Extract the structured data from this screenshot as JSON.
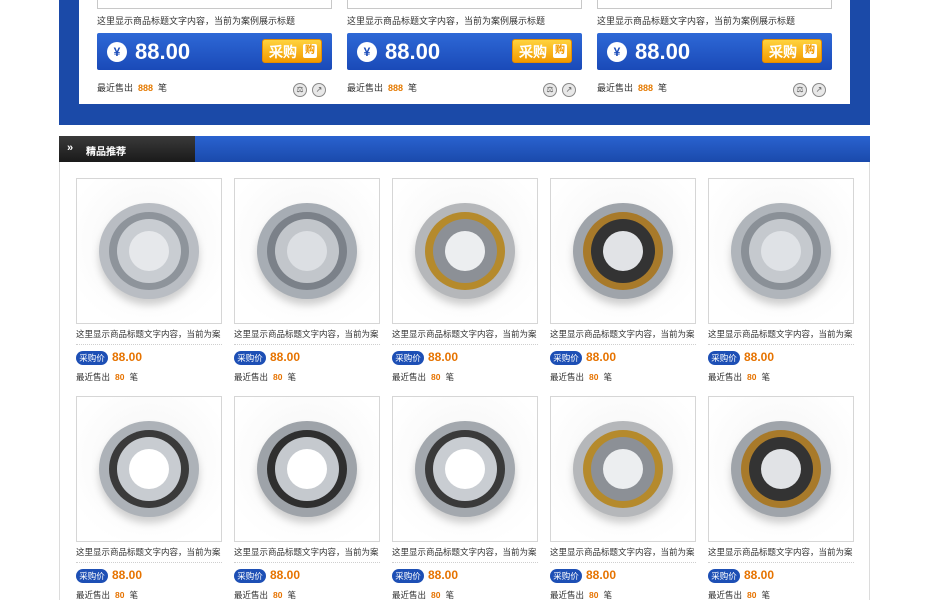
{
  "top_cards": [
    {
      "title": "这里显示商品标题文字内容，当前为案例展示标题",
      "currency": "¥",
      "price": "88.00",
      "buy_label": "采购",
      "basket": "购",
      "sold_prefix": "最近售出",
      "sold_count": "888",
      "sold_unit": "笔"
    },
    {
      "title": "这里显示商品标题文字内容，当前为案例展示标题",
      "currency": "¥",
      "price": "88.00",
      "buy_label": "采购",
      "basket": "购",
      "sold_prefix": "最近售出",
      "sold_count": "888",
      "sold_unit": "笔"
    },
    {
      "title": "这里显示商品标题文字内容，当前为案例展示标题",
      "currency": "¥",
      "price": "88.00",
      "buy_label": "采购",
      "basket": "购",
      "sold_prefix": "最近售出",
      "sold_count": "888",
      "sold_unit": "笔"
    }
  ],
  "section": {
    "chevron": "»",
    "title": "精品推荐"
  },
  "colors": {
    "brand_blue": "#1b4aa8",
    "price_orange": "#e67300",
    "buy_button": "#f29a00"
  },
  "products": [
    {
      "title": "这里显示商品标题文字内容，当前为案",
      "badge": "采购价",
      "price": "88.00",
      "sold_prefix": "最近售出",
      "sold_count": "80",
      "sold_unit": "笔",
      "image": "ball-bearing-open-cage-icon"
    },
    {
      "title": "这里显示商品标题文字内容，当前为案",
      "badge": "采购价",
      "price": "88.00",
      "sold_prefix": "最近售出",
      "sold_count": "80",
      "sold_unit": "笔",
      "image": "tapered-roller-bearing-icon"
    },
    {
      "title": "这里显示商品标题文字内容，当前为案",
      "badge": "采购价",
      "price": "88.00",
      "sold_prefix": "最近售出",
      "sold_count": "80",
      "sold_unit": "笔",
      "image": "thrust-bearing-icon"
    },
    {
      "title": "这里显示商品标题文字内容，当前为案",
      "badge": "采购价",
      "price": "88.00",
      "sold_prefix": "最近售出",
      "sold_count": "80",
      "sold_unit": "笔",
      "image": "brass-cage-bearing-icon"
    },
    {
      "title": "这里显示商品标题文字内容，当前为案",
      "badge": "采购价",
      "price": "88.00",
      "sold_prefix": "最近售出",
      "sold_count": "80",
      "sold_unit": "笔",
      "image": "shielded-bearing-pair-icon"
    },
    {
      "title": "这里显示商品标题文字内容，当前为案",
      "badge": "采购价",
      "price": "88.00",
      "sold_prefix": "最近售出",
      "sold_count": "80",
      "sold_unit": "笔",
      "image": "deep-groove-ball-bearing-icon"
    },
    {
      "title": "这里显示商品标题文字内容，当前为案",
      "badge": "采购价",
      "price": "88.00",
      "sold_prefix": "最近售出",
      "sold_count": "80",
      "sold_unit": "笔",
      "image": "thin-section-bearing-icon"
    },
    {
      "title": "这里显示商品标题文字内容，当前为案",
      "badge": "采购价",
      "price": "88.00",
      "sold_prefix": "最近售出",
      "sold_count": "80",
      "sold_unit": "笔",
      "image": "angular-contact-bearing-icon"
    },
    {
      "title": "这里显示商品标题文字内容，当前为案",
      "badge": "采购价",
      "price": "88.00",
      "sold_prefix": "最近售出",
      "sold_count": "80",
      "sold_unit": "笔",
      "image": "thrust-bearing-icon"
    },
    {
      "title": "这里显示商品标题文字内容，当前为案",
      "badge": "采购价",
      "price": "88.00",
      "sold_prefix": "最近售出",
      "sold_count": "80",
      "sold_unit": "笔",
      "image": "brass-cage-bearing-icon"
    }
  ]
}
